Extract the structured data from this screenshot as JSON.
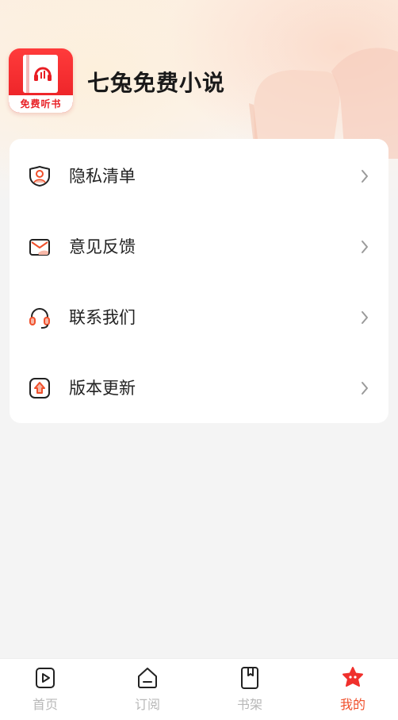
{
  "app": {
    "name": "七兔免费小说",
    "logo_text": "免费听书"
  },
  "menu": {
    "items": [
      {
        "label": "隐私清单",
        "icon": "privacy-icon"
      },
      {
        "label": "意见反馈",
        "icon": "mail-icon"
      },
      {
        "label": "联系我们",
        "icon": "headset-icon"
      },
      {
        "label": "版本更新",
        "icon": "update-icon"
      }
    ]
  },
  "tabbar": {
    "tabs": [
      {
        "label": "首页",
        "icon": "home-play-icon",
        "active": false
      },
      {
        "label": "订阅",
        "icon": "subscribe-icon",
        "active": false
      },
      {
        "label": "书架",
        "icon": "bookshelf-icon",
        "active": false
      },
      {
        "label": "我的",
        "icon": "profile-star-icon",
        "active": true
      }
    ]
  },
  "colors": {
    "accent": "#f0502c",
    "brand_red": "#e81e24",
    "inactive": "#b8b8b8",
    "icon_dark": "#222222"
  }
}
